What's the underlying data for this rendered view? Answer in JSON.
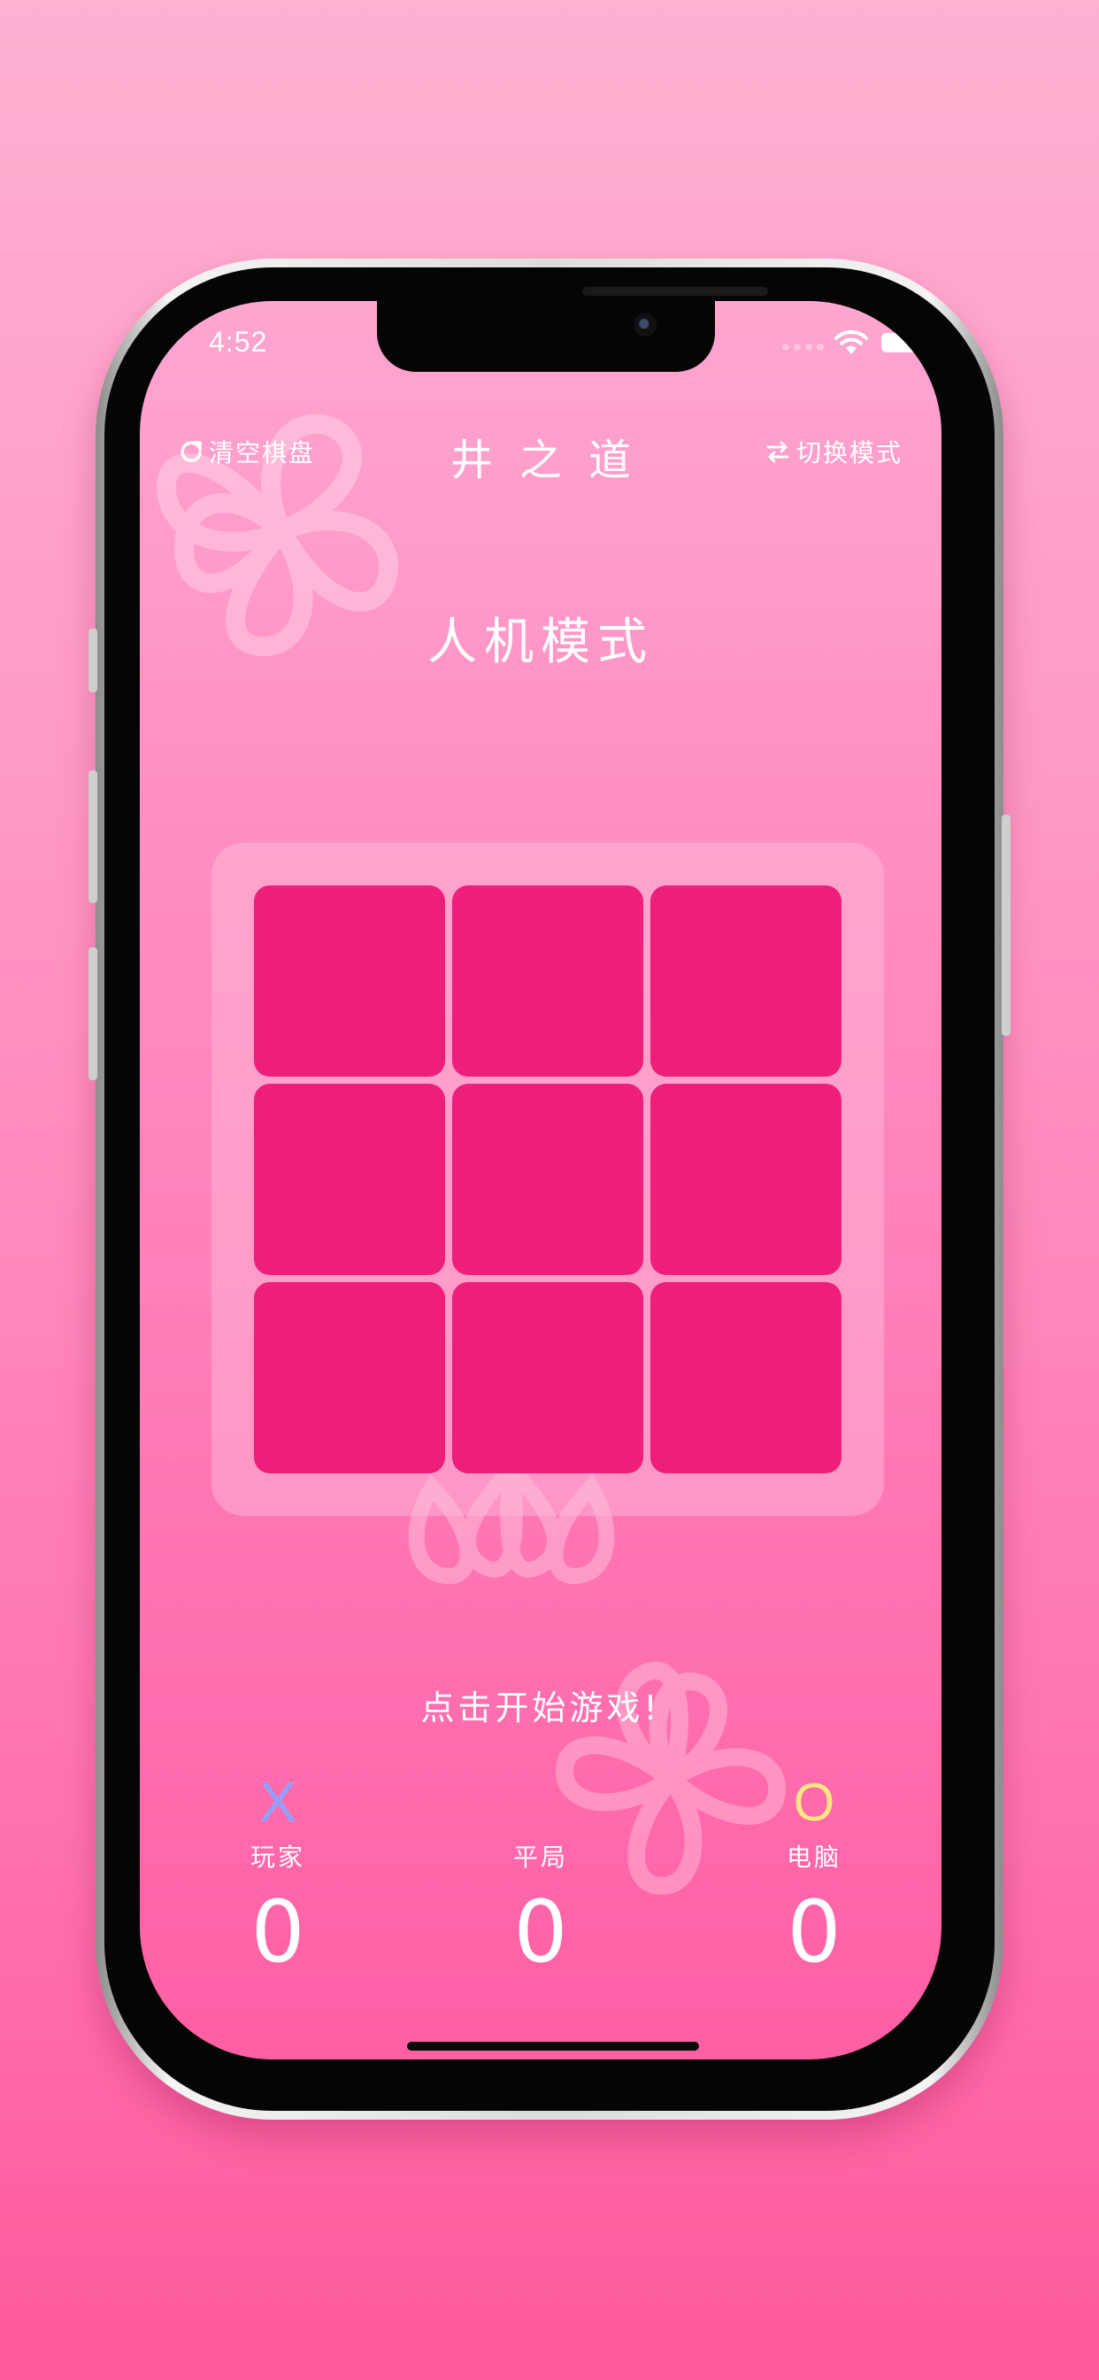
{
  "status_bar": {
    "time": "4:52"
  },
  "header": {
    "clear_label": "清空棋盘",
    "title": "井之道",
    "switch_label": "切换模式"
  },
  "mode_title": "人机模式",
  "board": {
    "cells": [
      "",
      "",
      "",
      "",
      "",
      "",
      "",
      "",
      ""
    ]
  },
  "hint": "点击开始游戏!",
  "scores": {
    "player": {
      "mark": "X",
      "label": "玩家",
      "value": "0"
    },
    "draw": {
      "label": "平局",
      "value": "0"
    },
    "computer": {
      "mark": "O",
      "label": "电脑",
      "value": "0"
    }
  },
  "colors": {
    "cell": "#ee1e7b",
    "player_mark": "#8fa0ff",
    "computer_mark": "#ffe680"
  }
}
